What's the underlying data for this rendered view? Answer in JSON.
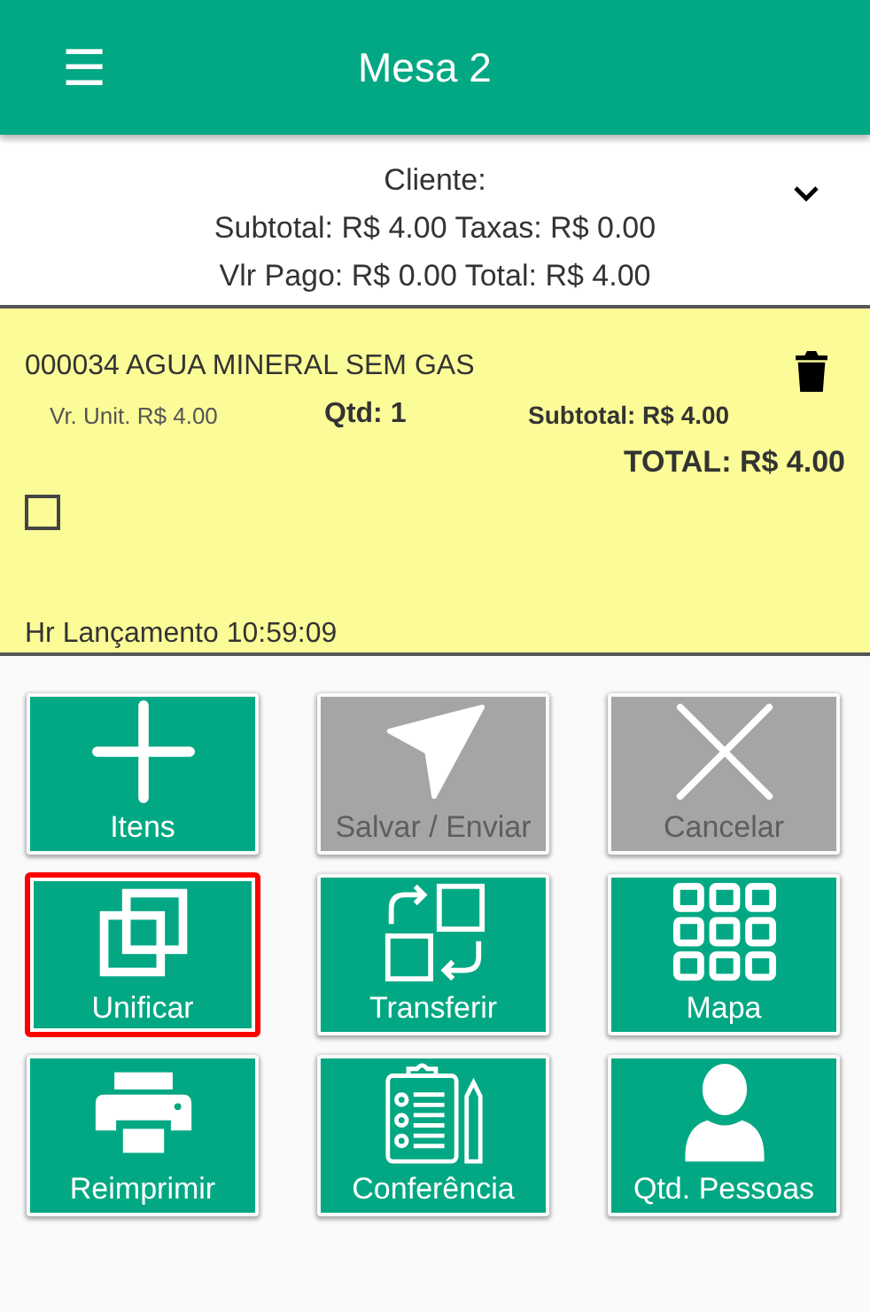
{
  "header": {
    "menu_icon": "☰",
    "title": "Mesa 2"
  },
  "summary": {
    "lines": [
      "Cliente:",
      "Subtotal: R$ 4.00 Taxas: R$ 0.00",
      "Vlr Pago: R$ 0.00 Total: R$ 4.00"
    ],
    "expanded": false
  },
  "items": [
    {
      "name": "000034 AGUA MINERAL SEM GAS",
      "unit_price": "Vr. Unit. R$ 4.00",
      "quantity": "Qtd: 1",
      "subtotal": "Subtotal: R$ 4.00",
      "total": "TOTAL: R$ 4.00",
      "checked": false,
      "launch_time": "Hr Lançamento 10:59:09"
    }
  ],
  "actions": [
    {
      "kind": "plus",
      "label": "Itens",
      "disabled": false,
      "selected": false
    },
    {
      "kind": "send",
      "label": "Salvar / Enviar",
      "disabled": true,
      "selected": false
    },
    {
      "kind": "close",
      "label": "Cancelar",
      "disabled": true,
      "selected": false
    },
    {
      "kind": "merge",
      "label": "Unificar",
      "disabled": false,
      "selected": true
    },
    {
      "kind": "transfer",
      "label": "Transferir",
      "disabled": false,
      "selected": false
    },
    {
      "kind": "grid",
      "label": "Mapa",
      "disabled": false,
      "selected": false
    },
    {
      "kind": "print",
      "label": "Reimprimir",
      "disabled": false,
      "selected": false
    },
    {
      "kind": "checklist",
      "label": "Conferência",
      "disabled": false,
      "selected": false
    },
    {
      "kind": "person",
      "label": "Qtd. Pessoas",
      "disabled": false,
      "selected": false
    }
  ]
}
